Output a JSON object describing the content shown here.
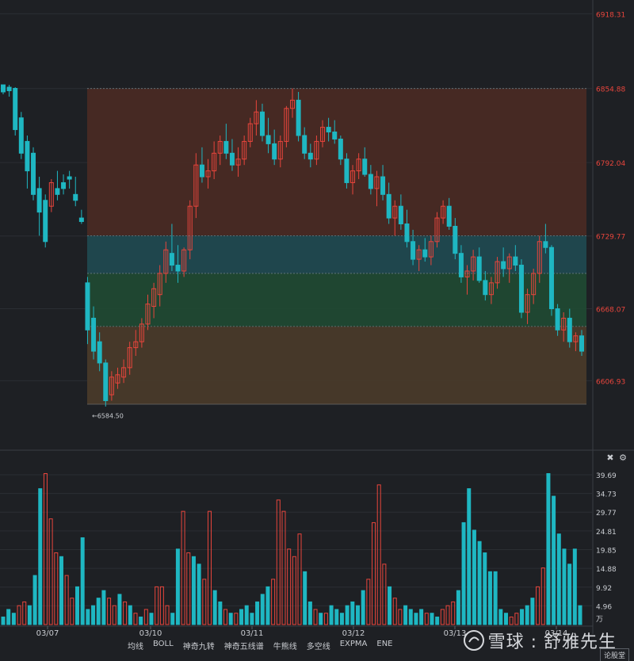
{
  "chart_data": [
    {
      "type": "candlestick",
      "title": "",
      "y_axis_labels": [
        "6918.31",
        "6854.88",
        "6792.04",
        "6729.77",
        "6668.07",
        "6606.93"
      ],
      "ylim": [
        6550,
        6930
      ],
      "x_labels": [
        "03/07",
        "03/10",
        "03/11",
        "03/12",
        "03/13",
        "03/14"
      ],
      "min_marker": "←6584.50",
      "bands": [
        {
          "name": "zone-top",
          "from": 6730,
          "to": 6854.88,
          "color": "#4a2a24"
        },
        {
          "name": "zone-teal",
          "from": 6698,
          "to": 6730,
          "color": "#1f4a52"
        },
        {
          "name": "zone-green",
          "from": 6653,
          "to": 6698,
          "color": "#1f4a33"
        },
        {
          "name": "zone-bottom",
          "from": 6587,
          "to": 6653,
          "color": "#4a3b2a"
        }
      ],
      "ohlc": [
        [
          6858,
          6858,
          6850,
          6852
        ],
        [
          6856,
          6858,
          6848,
          6853
        ],
        [
          6855,
          6856,
          6815,
          6820
        ],
        [
          6830,
          6835,
          6795,
          6800
        ],
        [
          6810,
          6815,
          6770,
          6785
        ],
        [
          6800,
          6805,
          6760,
          6765
        ],
        [
          6770,
          6780,
          6730,
          6750
        ],
        [
          6760,
          6765,
          6720,
          6725
        ],
        [
          6755,
          6778,
          6750,
          6775
        ],
        [
          6770,
          6785,
          6760,
          6765
        ],
        [
          6775,
          6782,
          6765,
          6770
        ],
        [
          6780,
          6785,
          6770,
          6778
        ],
        [
          6765,
          6780,
          6755,
          6760
        ],
        [
          6745,
          6752,
          6740,
          6742
        ],
        [
          6690,
          6695,
          6638,
          6650
        ],
        [
          6660,
          6670,
          6625,
          6632
        ],
        [
          6640,
          6648,
          6615,
          6622
        ],
        [
          6622,
          6625,
          6585,
          6590
        ],
        [
          6595,
          6615,
          6590,
          6610
        ],
        [
          6605,
          6618,
          6600,
          6612
        ],
        [
          6610,
          6625,
          6605,
          6618
        ],
        [
          6618,
          6640,
          6612,
          6635
        ],
        [
          6635,
          6650,
          6628,
          6640
        ],
        [
          6640,
          6660,
          6635,
          6655
        ],
        [
          6655,
          6680,
          6650,
          6672
        ],
        [
          6670,
          6690,
          6660,
          6685
        ],
        [
          6680,
          6705,
          6670,
          6698
        ],
        [
          6698,
          6725,
          6690,
          6718
        ],
        [
          6715,
          6740,
          6700,
          6705
        ],
        [
          6705,
          6722,
          6690,
          6700
        ],
        [
          6700,
          6720,
          6695,
          6718
        ],
        [
          6718,
          6760,
          6710,
          6755
        ],
        [
          6755,
          6800,
          6745,
          6790
        ],
        [
          6790,
          6805,
          6775,
          6780
        ],
        [
          6780,
          6795,
          6770,
          6785
        ],
        [
          6785,
          6810,
          6778,
          6800
        ],
        [
          6800,
          6815,
          6790,
          6810
        ],
        [
          6810,
          6825,
          6795,
          6800
        ],
        [
          6800,
          6812,
          6785,
          6790
        ],
        [
          6790,
          6805,
          6780,
          6795
        ],
        [
          6795,
          6815,
          6790,
          6810
        ],
        [
          6810,
          6830,
          6805,
          6825
        ],
        [
          6825,
          6845,
          6815,
          6835
        ],
        [
          6835,
          6842,
          6810,
          6815
        ],
        [
          6815,
          6830,
          6800,
          6808
        ],
        [
          6808,
          6820,
          6790,
          6795
        ],
        [
          6795,
          6815,
          6788,
          6810
        ],
        [
          6810,
          6840,
          6805,
          6838
        ],
        [
          6838,
          6855,
          6830,
          6845
        ],
        [
          6845,
          6852,
          6810,
          6815
        ],
        [
          6815,
          6822,
          6795,
          6800
        ],
        [
          6800,
          6808,
          6788,
          6795
        ],
        [
          6795,
          6815,
          6790,
          6810
        ],
        [
          6810,
          6828,
          6805,
          6822
        ],
        [
          6822,
          6830,
          6810,
          6818
        ],
        [
          6818,
          6828,
          6808,
          6812
        ],
        [
          6812,
          6815,
          6790,
          6795
        ],
        [
          6795,
          6800,
          6770,
          6775
        ],
        [
          6775,
          6790,
          6765,
          6785
        ],
        [
          6785,
          6800,
          6778,
          6795
        ],
        [
          6795,
          6805,
          6780,
          6782
        ],
        [
          6782,
          6790,
          6765,
          6770
        ],
        [
          6770,
          6785,
          6755,
          6780
        ],
        [
          6780,
          6790,
          6760,
          6765
        ],
        [
          6765,
          6775,
          6740,
          6745
        ],
        [
          6745,
          6760,
          6730,
          6755
        ],
        [
          6755,
          6765,
          6735,
          6740
        ],
        [
          6740,
          6752,
          6720,
          6725
        ],
        [
          6725,
          6735,
          6705,
          6710
        ],
        [
          6710,
          6722,
          6700,
          6718
        ],
        [
          6718,
          6728,
          6708,
          6712
        ],
        [
          6712,
          6730,
          6705,
          6725
        ],
        [
          6725,
          6750,
          6720,
          6745
        ],
        [
          6745,
          6760,
          6740,
          6755
        ],
        [
          6755,
          6762,
          6735,
          6738
        ],
        [
          6738,
          6745,
          6710,
          6715
        ],
        [
          6715,
          6722,
          6690,
          6695
        ],
        [
          6695,
          6705,
          6680,
          6700
        ],
        [
          6700,
          6718,
          6692,
          6712
        ],
        [
          6712,
          6720,
          6690,
          6692
        ],
        [
          6692,
          6700,
          6675,
          6680
        ],
        [
          6680,
          6695,
          6672,
          6690
        ],
        [
          6690,
          6712,
          6685,
          6708
        ],
        [
          6708,
          6720,
          6695,
          6702
        ],
        [
          6702,
          6715,
          6690,
          6712
        ],
        [
          6712,
          6722,
          6700,
          6705
        ],
        [
          6705,
          6710,
          6660,
          6665
        ],
        [
          6665,
          6685,
          6655,
          6680
        ],
        [
          6680,
          6702,
          6672,
          6698
        ],
        [
          6698,
          6730,
          6690,
          6725
        ],
        [
          6725,
          6740,
          6715,
          6720
        ],
        [
          6720,
          6722,
          6662,
          6668
        ],
        [
          6668,
          6672,
          6645,
          6650
        ],
        [
          6650,
          6665,
          6640,
          6660
        ],
        [
          6660,
          6668,
          6635,
          6640
        ],
        [
          6640,
          6648,
          6632,
          6645
        ],
        [
          6645,
          6650,
          6628,
          6632
        ]
      ],
      "volume_axis_labels": [
        "39.69",
        "34.73",
        "29.77",
        "24.81",
        "19.85",
        "14.88",
        "9.92",
        "4.96"
      ],
      "volume_unit": "万",
      "volume": [
        [
          2,
          0
        ],
        [
          4,
          0
        ],
        [
          3,
          0
        ],
        [
          5,
          1
        ],
        [
          6,
          1
        ],
        [
          5,
          0
        ],
        [
          13,
          0
        ],
        [
          36,
          0
        ],
        [
          40,
          1
        ],
        [
          28,
          1
        ],
        [
          19,
          1
        ],
        [
          18,
          0
        ],
        [
          13,
          1
        ],
        [
          7,
          1
        ],
        [
          10,
          0
        ],
        [
          23,
          0
        ],
        [
          4,
          0
        ],
        [
          5,
          0
        ],
        [
          7,
          0
        ],
        [
          9,
          0
        ],
        [
          7,
          1
        ],
        [
          5,
          1
        ],
        [
          8,
          0
        ],
        [
          6,
          1
        ],
        [
          5,
          0
        ],
        [
          3,
          1
        ],
        [
          2,
          0
        ],
        [
          4,
          1
        ],
        [
          3,
          0
        ],
        [
          10,
          1
        ],
        [
          10,
          1
        ],
        [
          5,
          1
        ],
        [
          3,
          0
        ],
        [
          20,
          0
        ],
        [
          30,
          1
        ],
        [
          19,
          1
        ],
        [
          18,
          0
        ],
        [
          16,
          0
        ],
        [
          12,
          1
        ],
        [
          30,
          1
        ],
        [
          9,
          0
        ],
        [
          6,
          0
        ],
        [
          4,
          1
        ],
        [
          3,
          0
        ],
        [
          3,
          1
        ],
        [
          4,
          0
        ],
        [
          5,
          0
        ],
        [
          3,
          0
        ],
        [
          6,
          0
        ],
        [
          8,
          0
        ],
        [
          10,
          0
        ],
        [
          12,
          1
        ],
        [
          33,
          1
        ],
        [
          30,
          1
        ],
        [
          20,
          1
        ],
        [
          18,
          1
        ],
        [
          24,
          1
        ],
        [
          14,
          0
        ],
        [
          6,
          0
        ],
        [
          4,
          1
        ],
        [
          3,
          0
        ],
        [
          3,
          1
        ],
        [
          5,
          0
        ],
        [
          4,
          0
        ],
        [
          3,
          0
        ],
        [
          5,
          0
        ],
        [
          6,
          0
        ],
        [
          5,
          0
        ],
        [
          9,
          0
        ],
        [
          12,
          1
        ],
        [
          27,
          1
        ],
        [
          37,
          1
        ],
        [
          16,
          1
        ],
        [
          10,
          0
        ],
        [
          7,
          1
        ],
        [
          4,
          1
        ],
        [
          5,
          0
        ],
        [
          4,
          0
        ],
        [
          3,
          0
        ],
        [
          4,
          0
        ],
        [
          3,
          1
        ],
        [
          3,
          0
        ],
        [
          2,
          0
        ],
        [
          4,
          1
        ],
        [
          5,
          1
        ],
        [
          6,
          1
        ],
        [
          9,
          0
        ],
        [
          27,
          0
        ],
        [
          36,
          0
        ],
        [
          25,
          0
        ],
        [
          22,
          0
        ],
        [
          19,
          0
        ],
        [
          14,
          0
        ],
        [
          14,
          0
        ],
        [
          4,
          0
        ],
        [
          3,
          0
        ],
        [
          2,
          1
        ],
        [
          3,
          1
        ],
        [
          4,
          0
        ],
        [
          5,
          0
        ],
        [
          7,
          0
        ],
        [
          10,
          1
        ],
        [
          15,
          1
        ],
        [
          40,
          0
        ],
        [
          34,
          0
        ],
        [
          24,
          0
        ],
        [
          20,
          0
        ],
        [
          16,
          0
        ],
        [
          20,
          0
        ],
        [
          5,
          0
        ]
      ]
    }
  ],
  "toolbar": {
    "items": [
      "均线",
      "BOLL",
      "神奇九转",
      "神奇五线谱",
      "牛熊线",
      "多空线",
      "EXPMA",
      "ENE"
    ]
  },
  "watermark": {
    "text": "雪球 : 舒雅先生"
  },
  "corner_button": "论股堂",
  "colors": {
    "up": "#e8453c",
    "down": "#1fb7c2",
    "bg": "#1e2024",
    "axis_text_red": "#e8453c",
    "axis_text": "#c9ccd1",
    "grid": "#2b2e33"
  },
  "icons": [
    "close-icon",
    "gear-icon",
    "snowball-logo-icon"
  ]
}
